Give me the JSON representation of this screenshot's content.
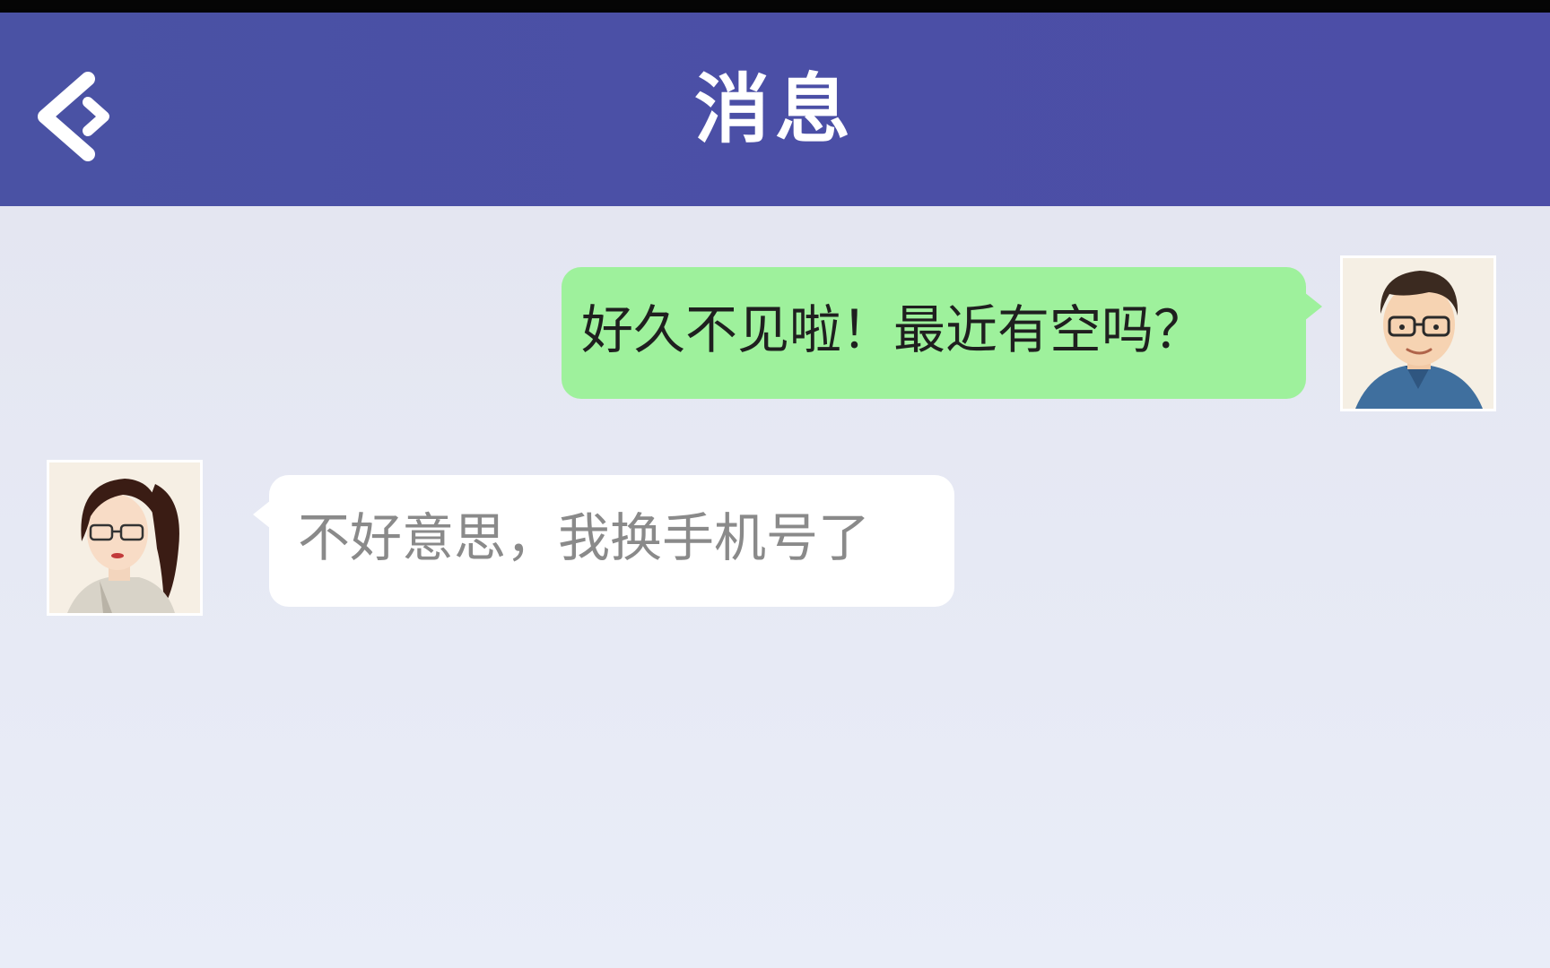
{
  "header": {
    "title": "消息",
    "back_icon": "back-arrow-icon",
    "background": "#4b4fa6"
  },
  "messages": [
    {
      "sender": "me",
      "text": "好久不见啦！最近有空吗？",
      "bubble_color": "#9ef19c",
      "avatar_icon": "male-avatar"
    },
    {
      "sender": "contact",
      "text": "不好意思，我换手机号了",
      "bubble_color": "#ffffff",
      "avatar_icon": "female-avatar"
    }
  ]
}
